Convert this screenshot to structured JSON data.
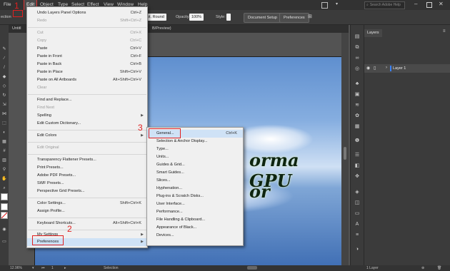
{
  "menubar": {
    "items": [
      "File",
      "Edit",
      "Object",
      "Type",
      "Select",
      "Effect",
      "View",
      "Window",
      "Help"
    ],
    "search_placeholder": "Search Adobe Help"
  },
  "controlbar": {
    "left_label": "ection",
    "stroke_style": "pt. Round",
    "opacity_label": "Opacity:",
    "opacity_value": "100%",
    "style_label": "Style:",
    "document_setup": "Document Setup",
    "preferences": "Preferences"
  },
  "tabbar": {
    "tab_left": "Untitl",
    "tab_right": "B/Preview)"
  },
  "edit_menu": {
    "items": [
      {
        "label": "Undo Layers Panel Options",
        "shortcut": "Ctrl+Z",
        "disabled": false
      },
      {
        "label": "Redo",
        "shortcut": "Shift+Ctrl+Z",
        "disabled": true
      },
      {
        "label": "Cut",
        "shortcut": "Ctrl+X",
        "disabled": true
      },
      {
        "label": "Copy",
        "shortcut": "Ctrl+C",
        "disabled": true
      },
      {
        "label": "Paste",
        "shortcut": "Ctrl+V",
        "disabled": false
      },
      {
        "label": "Paste in Front",
        "shortcut": "Ctrl+F",
        "disabled": false
      },
      {
        "label": "Paste in Back",
        "shortcut": "Ctrl+B",
        "disabled": false
      },
      {
        "label": "Paste in Place",
        "shortcut": "Shift+Ctrl+V",
        "disabled": false
      },
      {
        "label": "Paste on All Artboards",
        "shortcut": "Alt+Shift+Ctrl+V",
        "disabled": false
      },
      {
        "label": "Clear",
        "shortcut": "",
        "disabled": true
      },
      {
        "label": "Find and Replace...",
        "shortcut": "",
        "disabled": false
      },
      {
        "label": "Find Next",
        "shortcut": "",
        "disabled": true
      },
      {
        "label": "Spelling",
        "shortcut": "",
        "disabled": false
      },
      {
        "label": "Edit Custom Dictionary...",
        "shortcut": "",
        "disabled": false
      },
      {
        "label": "Edit Colors",
        "shortcut": "",
        "disabled": false
      },
      {
        "label": "Edit Original",
        "shortcut": "",
        "disabled": true
      },
      {
        "label": "Transparency Flattener Presets...",
        "shortcut": "",
        "disabled": false
      },
      {
        "label": "Print Presets...",
        "shortcut": "",
        "disabled": false
      },
      {
        "label": "Adobe PDF Presets...",
        "shortcut": "",
        "disabled": false
      },
      {
        "label": "SWF Presets...",
        "shortcut": "",
        "disabled": false
      },
      {
        "label": "Perspective Grid Presets...",
        "shortcut": "",
        "disabled": false
      },
      {
        "label": "Color Settings...",
        "shortcut": "Shift+Ctrl+K",
        "disabled": false
      },
      {
        "label": "Assign Profile...",
        "shortcut": "",
        "disabled": false
      },
      {
        "label": "Keyboard Shortcuts...",
        "shortcut": "Alt+Shift+Ctrl+K",
        "disabled": false
      },
      {
        "label": "My Settings",
        "shortcut": "",
        "disabled": false
      },
      {
        "label": "Preferences",
        "shortcut": "",
        "disabled": false
      }
    ]
  },
  "preferences_menu": {
    "items": [
      {
        "label": "General...",
        "shortcut": "Ctrl+K"
      },
      {
        "label": "Selection & Anchor Display...",
        "shortcut": ""
      },
      {
        "label": "Type...",
        "shortcut": ""
      },
      {
        "label": "Units...",
        "shortcut": ""
      },
      {
        "label": "Guides & Grid...",
        "shortcut": ""
      },
      {
        "label": "Smart Guides...",
        "shortcut": ""
      },
      {
        "label": "Slices...",
        "shortcut": ""
      },
      {
        "label": "Hyphenation...",
        "shortcut": ""
      },
      {
        "label": "Plug-ins & Scratch Disks...",
        "shortcut": ""
      },
      {
        "label": "User Interface...",
        "shortcut": ""
      },
      {
        "label": "Performance...",
        "shortcut": ""
      },
      {
        "label": "File Handling & Clipboard...",
        "shortcut": ""
      },
      {
        "label": "Appearance of Black...",
        "shortcut": ""
      },
      {
        "label": "Devices...",
        "shortcut": ""
      }
    ]
  },
  "artwork": {
    "line1": "orma GPU",
    "line2": "or"
  },
  "annotations": {
    "step1": "1",
    "step2": "2",
    "step3": "3",
    "color": "#e02020"
  },
  "layers_panel": {
    "tab": "Layers",
    "layer_name": "Layer 1",
    "footer": "1 Layer"
  },
  "statusbar": {
    "zoom": "12.96%",
    "artboard": "1",
    "tool": "Selection"
  },
  "colors": {
    "ui_dark": "#323232",
    "menu_bg": "#f0f0f0",
    "highlight": "#cfe2f6"
  }
}
